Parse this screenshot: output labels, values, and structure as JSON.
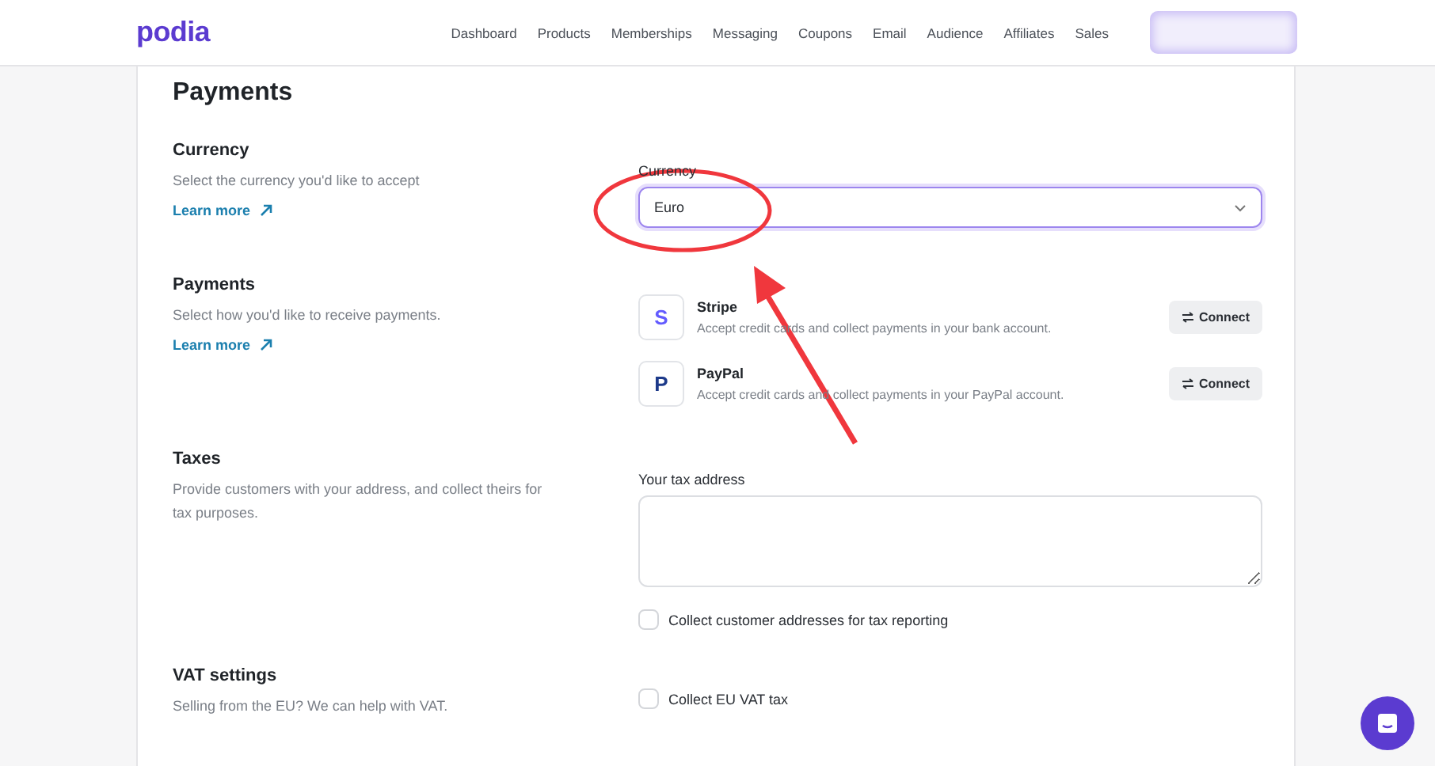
{
  "header": {
    "logo": "podia",
    "nav": [
      "Dashboard",
      "Products",
      "Memberships",
      "Messaging",
      "Coupons",
      "Email",
      "Audience",
      "Affiliates",
      "Sales"
    ]
  },
  "page_title": "Payments",
  "sections": [
    {
      "kind": "select",
      "title": "Currency",
      "description": "Select the currency you'd like to accept",
      "link": "Learn more",
      "field_label": "Currency",
      "value": "Euro"
    },
    {
      "kind": "providers",
      "title": "Payments",
      "description": "Select how you'd like to receive payments.",
      "link": "Learn more",
      "providers": [
        {
          "logo": "S",
          "name": "Stripe",
          "description": "Accept credit cards and collect payments in your bank account.",
          "button": "Connect"
        },
        {
          "logo": "P",
          "name": "PayPal",
          "description": "Accept credit cards and collect payments in your PayPal account.",
          "button": "Connect"
        }
      ]
    },
    {
      "kind": "address",
      "title": "Taxes",
      "description": "Provide customers with your address, and collect theirs for tax purposes.",
      "field_label": "Your tax address",
      "checkbox": {
        "label": "Collect customer addresses for tax reporting",
        "checked": false
      }
    },
    {
      "kind": "checkbox",
      "title": "VAT settings",
      "description": "Selling from the EU? We can help with VAT.",
      "checkbox": {
        "label": "Collect EU VAT tax",
        "checked": false
      }
    }
  ]
}
